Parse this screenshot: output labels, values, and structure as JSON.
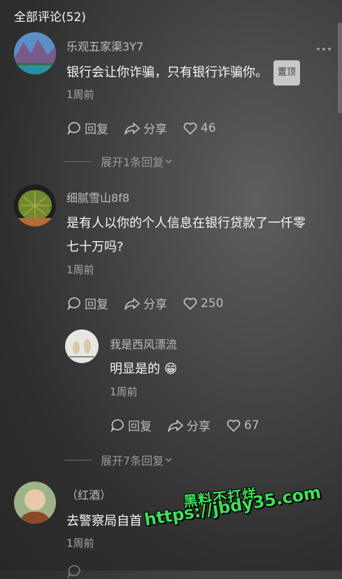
{
  "header": {
    "title": "全部评论(52)"
  },
  "comments": [
    {
      "username": "乐观五家渠3Y7",
      "text": "银行会让你诈骗，只有银行诈骗你。",
      "badge": "置顶",
      "time": "1周前",
      "reply_label": "回复",
      "share_label": "分享",
      "likes": "46",
      "expand_label": "展开1条回复"
    },
    {
      "username": "细腻雪山8f8",
      "text_line1": "是有人以你的个人信息在银行贷款了一仟零",
      "text_line2": "七十万吗?",
      "time": "1周前",
      "reply_label": "回复",
      "share_label": "分享",
      "likes": "250",
      "reply": {
        "username": "我是西风漂流",
        "text": "明显是的",
        "emoji": "😁",
        "time": "1周前",
        "reply_label": "回复",
        "share_label": "分享",
        "likes": "67"
      },
      "expand_label": "展开7条回复"
    },
    {
      "username": "（红酒）",
      "text": "去警察局自首",
      "time": "1周前"
    }
  ],
  "watermark": {
    "line1": "黑料不打烊",
    "line2": "https://jbdy35.com"
  },
  "icons": [
    "more-icon",
    "reply-icon",
    "share-icon",
    "heart-icon",
    "chevron-down-icon"
  ]
}
